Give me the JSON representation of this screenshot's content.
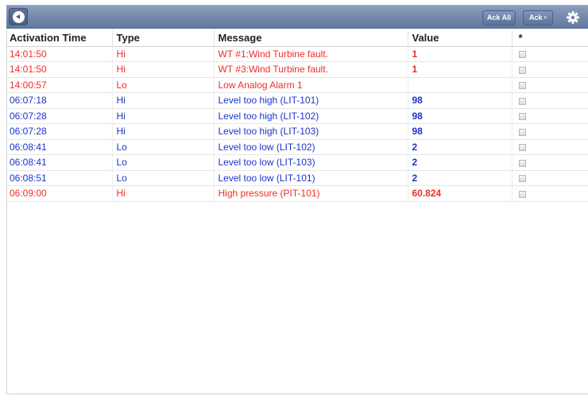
{
  "toolbar": {
    "ack_all_label": "Ack All",
    "ack_label": "Ack",
    "ack_caret": "˅"
  },
  "columns": {
    "activation_time": "Activation Time",
    "type": "Type",
    "message": "Message",
    "value": "Value",
    "ack": "*"
  },
  "colors": {
    "toolbar": "#6f84a8",
    "red_alarm": "#ee2d2d",
    "blue_alarm": "#1b34cc"
  },
  "icons": {
    "back": "back-icon",
    "settings": "gear-icon"
  },
  "alarms": [
    {
      "time": "14:01:50",
      "type": "Hi",
      "message": "WT #1:Wind Turbine fault.",
      "value": "1",
      "severity": "red"
    },
    {
      "time": "14:01:50",
      "type": "Hi",
      "message": "WT #3:Wind Turbine fault.",
      "value": "1",
      "severity": "red"
    },
    {
      "time": "14:00:57",
      "type": "Lo",
      "message": "Low Analog Alarm 1",
      "value": "",
      "severity": "red"
    },
    {
      "time": "06:07:18",
      "type": "Hi",
      "message": "Level too high (LIT-101)",
      "value": "98",
      "severity": "blue"
    },
    {
      "time": "06:07:28",
      "type": "Hi",
      "message": "Level too high (LIT-102)",
      "value": "98",
      "severity": "blue"
    },
    {
      "time": "06:07:28",
      "type": "Hi",
      "message": "Level too high (LIT-103)",
      "value": "98",
      "severity": "blue"
    },
    {
      "time": "06:08:41",
      "type": "Lo",
      "message": "Level too low (LIT-102)",
      "value": "2",
      "severity": "blue"
    },
    {
      "time": "06:08:41",
      "type": "Lo",
      "message": "Level too low (LIT-103)",
      "value": "2",
      "severity": "blue"
    },
    {
      "time": "06:08:51",
      "type": "Lo",
      "message": "Level too low (LIT-101)",
      "value": "2",
      "severity": "blue"
    },
    {
      "time": "06:09:00",
      "type": "Hi",
      "message": "High pressure (PIT-101)",
      "value": "60.824",
      "severity": "red"
    }
  ]
}
